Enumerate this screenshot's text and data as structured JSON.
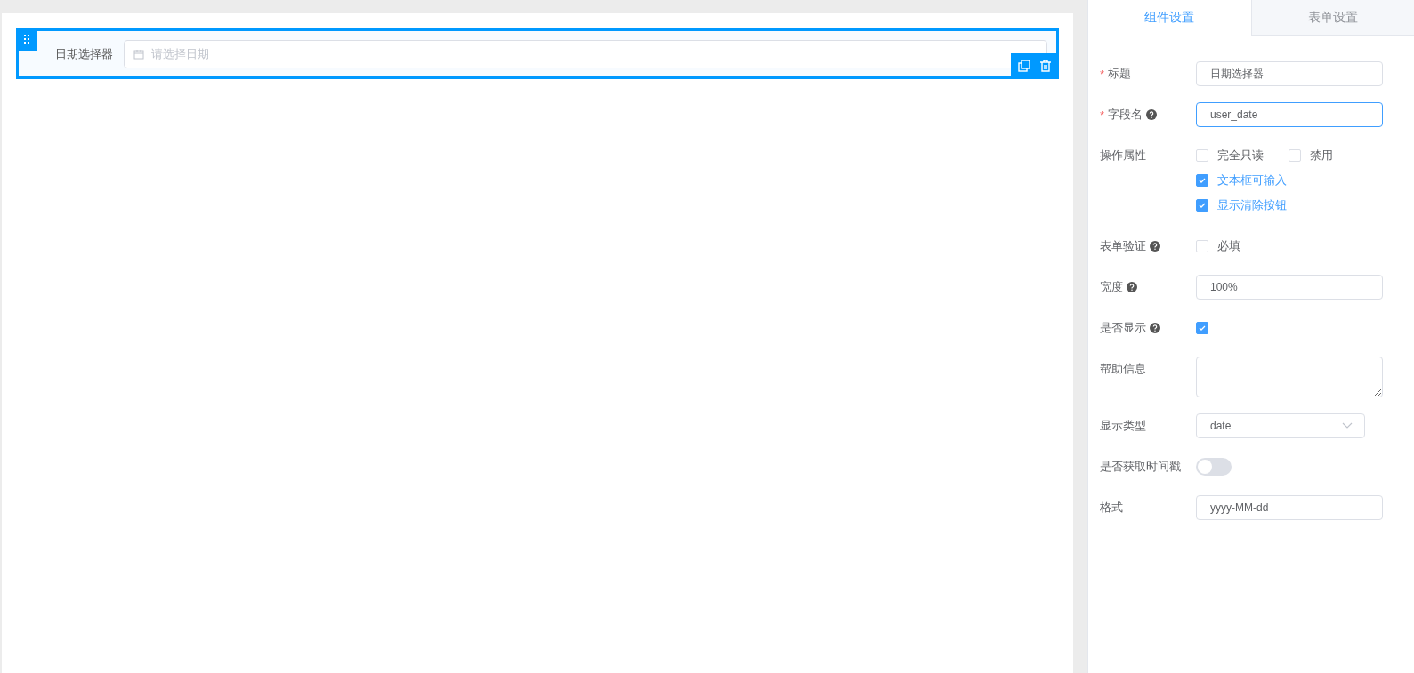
{
  "canvas": {
    "widget": {
      "label": "日期选择器",
      "placeholder": "请选择日期",
      "selected": true
    }
  },
  "tabs": [
    {
      "label": "组件设置",
      "selected": true
    },
    {
      "label": "表单设置",
      "selected": false
    }
  ],
  "properties": [
    {
      "kind": "input",
      "required_mark": "*",
      "label": "标题",
      "value": "日期选择器",
      "focused": false
    },
    {
      "kind": "input",
      "required_mark": "*",
      "label": "字段名",
      "help": true,
      "value": "user_date",
      "focused": true
    },
    {
      "kind": "checks",
      "label": "操作属性",
      "lines": [
        {
          "options": [
            {
              "label": "完全只读",
              "checked": false
            },
            {
              "label": "禁用",
              "checked": false
            }
          ]
        },
        {
          "options": [
            {
              "label": "文本框可输入",
              "checked": true
            }
          ]
        },
        {
          "options": [
            {
              "label": "显示清除按钮",
              "checked": true
            }
          ]
        }
      ]
    },
    {
      "kind": "checks",
      "label": "表单验证",
      "help": true,
      "lines": [
        {
          "options": [
            {
              "label": "必填",
              "checked": false
            }
          ]
        }
      ]
    },
    {
      "kind": "input",
      "label": "宽度",
      "help": true,
      "value": "100%",
      "focused": false
    },
    {
      "kind": "checkbox",
      "label": "是否显示",
      "help": true,
      "checked": true
    },
    {
      "kind": "textarea",
      "label": "帮助信息"
    },
    {
      "kind": "select",
      "label": "显示类型",
      "value": "date"
    },
    {
      "kind": "switch",
      "label": "是否获取时间戳",
      "on": false
    },
    {
      "kind": "input",
      "label": "格式",
      "value": "yyyy-MM-dd",
      "focused": false
    }
  ]
}
